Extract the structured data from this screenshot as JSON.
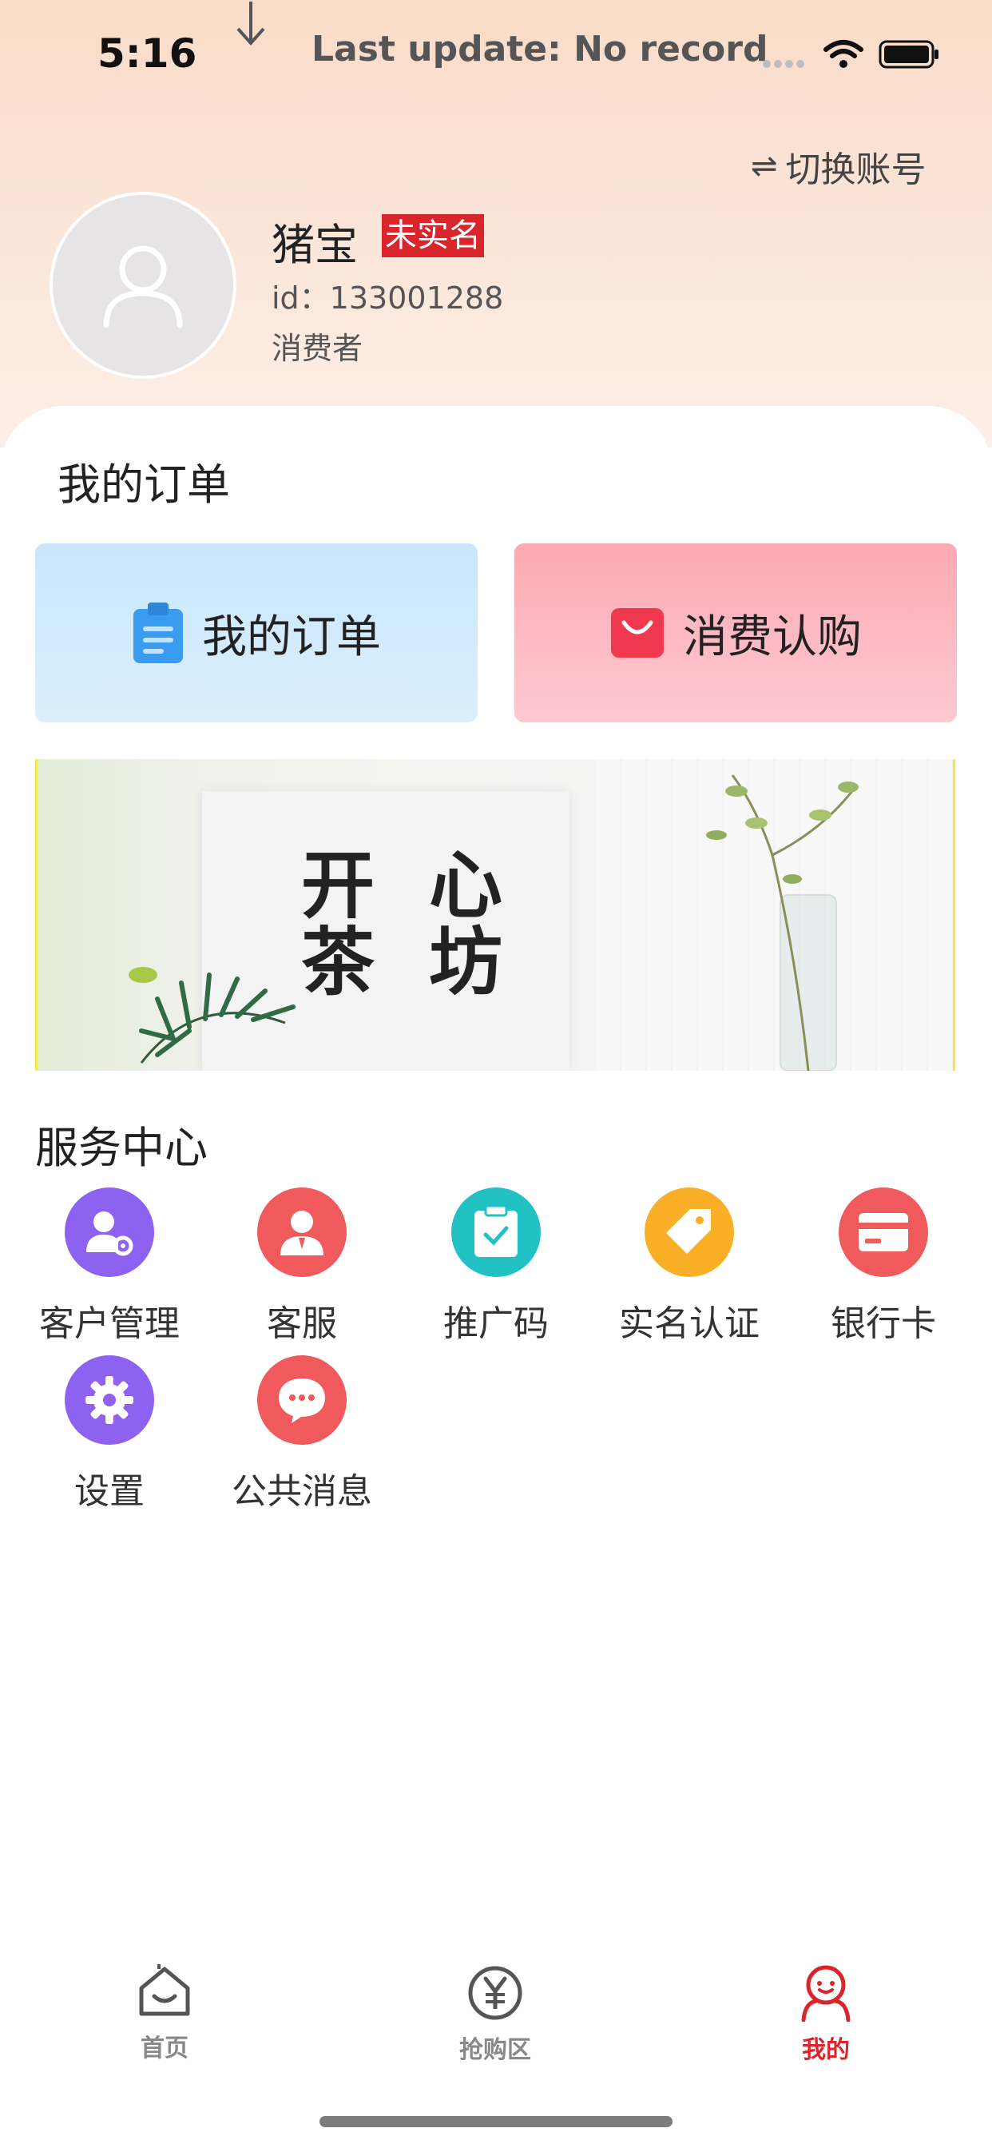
{
  "status_bar": {
    "time": "5:16",
    "last_update": "Last update: No record"
  },
  "header": {
    "switch_account": "切换账号",
    "username": "猪宝",
    "realname_badge": "未实名",
    "user_id": "id：133001288",
    "role": "消费者"
  },
  "orders": {
    "section_title": "我的订单",
    "my_orders_label": "我的订单",
    "consumer_purchase_label": "消费认购"
  },
  "banner": {
    "line1": "开 心",
    "line2": "茶 坊"
  },
  "services": {
    "title": "服务中心",
    "items": [
      {
        "label": "客户管理",
        "icon": "customer-management-icon",
        "color": "#8e62f0"
      },
      {
        "label": "客服",
        "icon": "customer-service-icon",
        "color": "#f05a5d"
      },
      {
        "label": "推广码",
        "icon": "promo-code-icon",
        "color": "#22c1c3"
      },
      {
        "label": "实名认证",
        "icon": "real-name-tag-icon",
        "color": "#f9b026"
      },
      {
        "label": "银行卡",
        "icon": "bank-card-icon",
        "color": "#f05a5d"
      },
      {
        "label": "设置",
        "icon": "gear-icon",
        "color": "#8e62f0"
      },
      {
        "label": "公共消息",
        "icon": "message-icon",
        "color": "#f05a5d"
      }
    ]
  },
  "tabbar": {
    "items": [
      {
        "label": "首页",
        "icon": "home-icon"
      },
      {
        "label": "抢购区",
        "icon": "yuan-icon"
      },
      {
        "label": "我的",
        "icon": "profile-icon",
        "active": true
      }
    ]
  },
  "colors": {
    "accent": "#d8262c",
    "header_bg": "#f9dcc9"
  }
}
